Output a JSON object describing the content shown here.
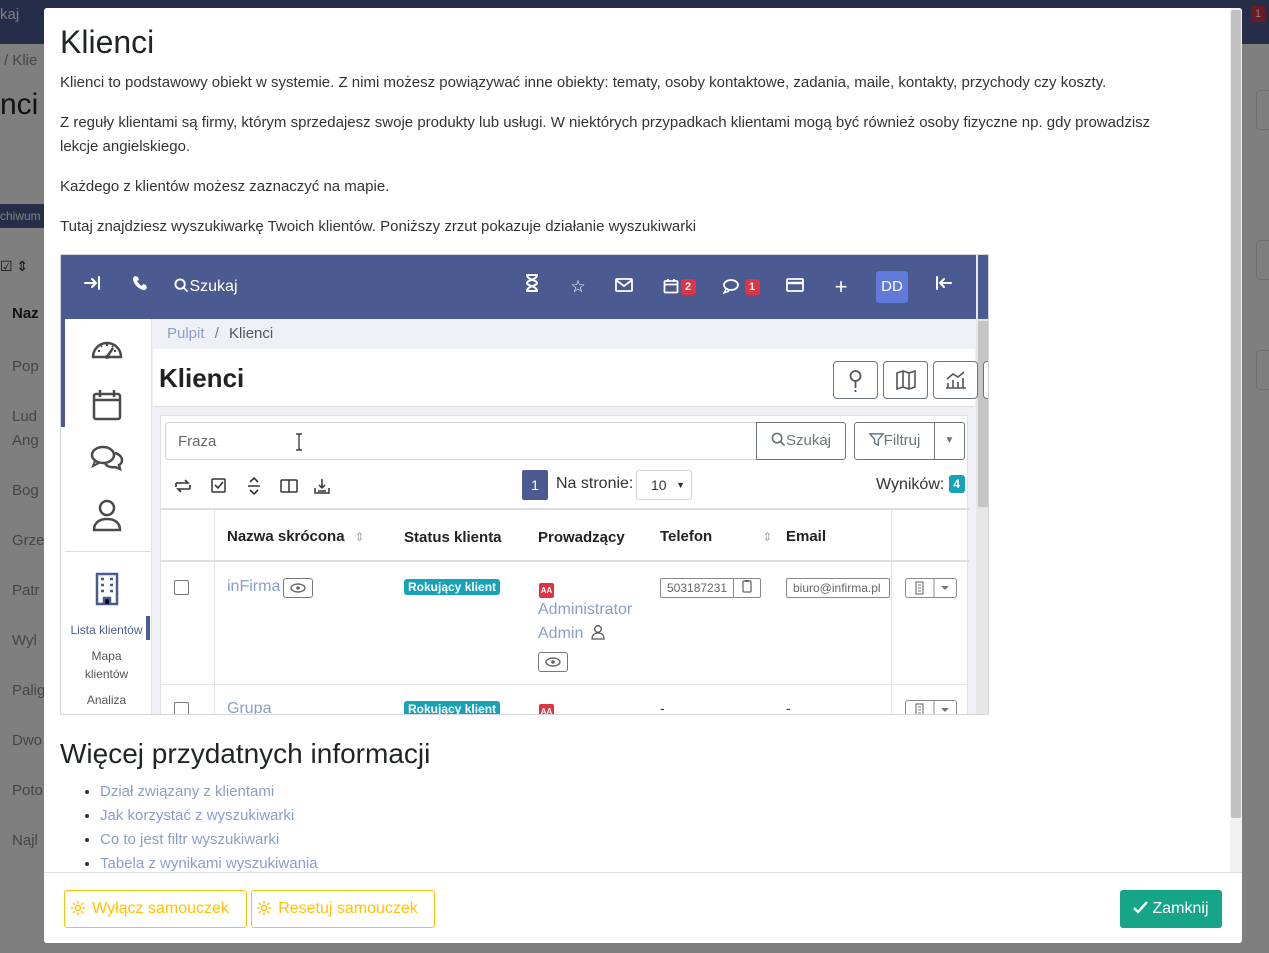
{
  "background": {
    "topbar_text": "kaj",
    "badge": "1",
    "breadcrumb": "/ Klie",
    "page_title": "nci",
    "archive_label": "chiwum",
    "column_header": "Naz",
    "rows": [
      "Pop",
      "Lud",
      "Ang",
      "Bog",
      "Grze",
      "Patr",
      "Wyl",
      "Palig",
      "Dwo",
      "Poto",
      "Najl"
    ]
  },
  "modal": {
    "title": "Klienci",
    "paragraphs": [
      "Klienci to podstawowy obiekt w systemie. Z nimi możesz powiązywać inne obiekty: tematy, osoby kontaktowe, zadania, maile, kontakty, przychody czy koszty.",
      "Z reguły klientami są firmy, którym sprzedajesz swoje produkty lub usługi. W niektórych przypadkach klientami mogą być również osoby fizyczne np. gdy prowadzisz lekcje angielskiego.",
      "Każdego z klientów możesz zaznaczyć na mapie.",
      "Tutaj znajdziesz wyszukiwarkę Twoich klientów. Poniższy zrzut pokazuje działanie wyszukiwarki"
    ],
    "more_heading": "Więcej przydatnych informacji",
    "links": [
      "Dział związany z klientami",
      "Jak korzystać z wyszukiwarki",
      "Co to jest filtr wyszukiwarki",
      "Tabela z wynikami wyszukiwania"
    ],
    "footer": {
      "disable_tutorial": "Wyłącz samouczek",
      "reset_tutorial": "Resetuj samouczek",
      "close": "Zamknij"
    }
  },
  "screenshot": {
    "nav": {
      "search": "Szukaj",
      "calendar_badge": "2",
      "chat_badge": "1",
      "avatar": "DD"
    },
    "sidebar": {
      "list": "Lista klientów",
      "map_1": "Mapa",
      "map_2": "klientów",
      "analysis": "Analiza"
    },
    "breadcrumb": {
      "root": "Pulpit",
      "sep": "/",
      "current": "Klienci"
    },
    "title": "Klienci",
    "search_placeholder": "Fraza",
    "search_button": "Szukaj",
    "filter_button": "Filtruj",
    "page_number": "1",
    "per_page_label": "Na stronie:",
    "per_page_value": "10",
    "results_label": "Wyników:",
    "results_count": "4",
    "columns": [
      "Nazwa skrócona",
      "Status klienta",
      "Prowadzący",
      "Telefon",
      "Email"
    ],
    "rows": [
      {
        "name": "inFirma",
        "status": "Rokujący klient",
        "owner_initials": "AA",
        "owner_line1": "Administrator",
        "owner_line2": "Admin",
        "phone": "503187231",
        "email": "biuro@infirma.pl"
      },
      {
        "name": "Grupa",
        "status": "Rokujący klient",
        "owner_initials": "AA",
        "phone": "-",
        "email": "-"
      }
    ]
  }
}
